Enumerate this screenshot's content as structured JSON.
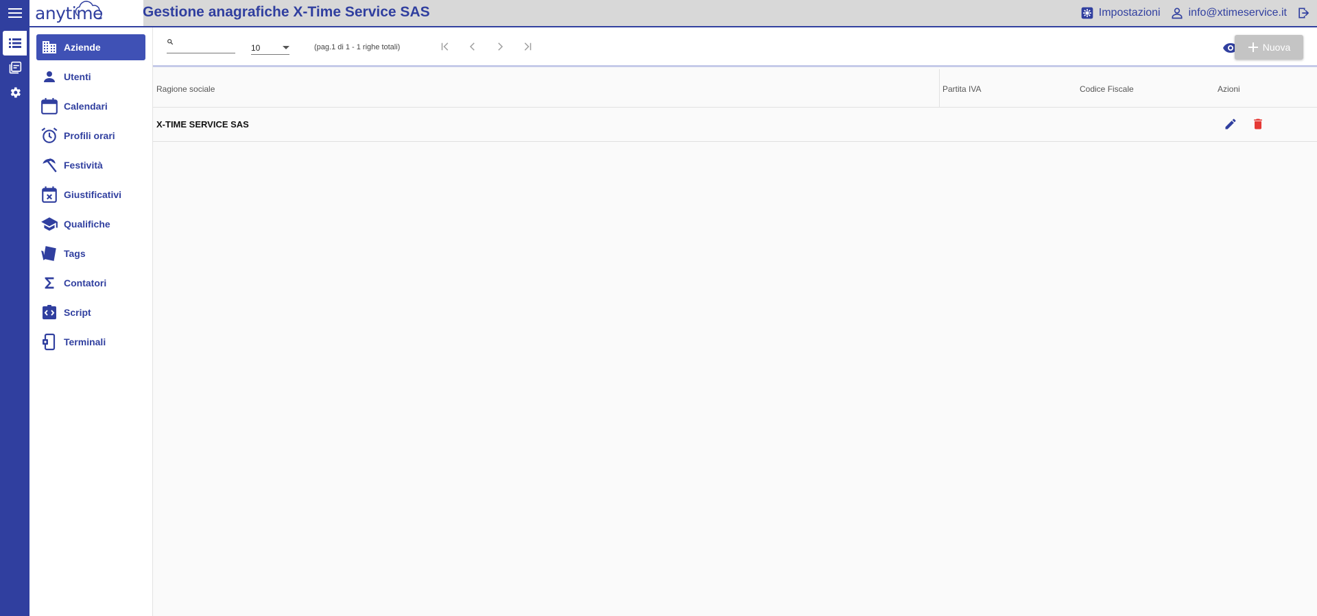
{
  "header": {
    "logo_text": "anytime",
    "title": "Gestione anagrafiche X-Time Service SAS",
    "settings_label": "Impostazioni",
    "user_label": "info@xtimeservice.it"
  },
  "rail": {
    "items": [
      {
        "icon": "list-icon",
        "active": true
      },
      {
        "icon": "library-icon",
        "active": false
      },
      {
        "icon": "gear-icon",
        "active": false
      }
    ]
  },
  "nav": {
    "items": [
      {
        "label": "Aziende",
        "icon": "building-icon",
        "active": true
      },
      {
        "label": "Utenti",
        "icon": "person-icon"
      },
      {
        "label": "Calendari",
        "icon": "calendar-icon"
      },
      {
        "label": "Profili orari",
        "icon": "alarm-icon"
      },
      {
        "label": "Festività",
        "icon": "beach-umbrella-icon"
      },
      {
        "label": "Giustificativi",
        "icon": "event-busy-icon"
      },
      {
        "label": "Qualifiche",
        "icon": "school-icon"
      },
      {
        "label": "Tags",
        "icon": "tag-icon"
      },
      {
        "label": "Contatori",
        "icon": "sigma-icon"
      },
      {
        "label": "Script",
        "icon": "code-icon"
      },
      {
        "label": "Terminali",
        "icon": "device-settings-icon"
      }
    ]
  },
  "toolbar": {
    "search_value": "",
    "page_size": "10",
    "page_info": "(pag.1 di 1 - 1 righe totali)",
    "new_label": "Nuova"
  },
  "table": {
    "columns": [
      "Ragione sociale",
      "Partita IVA",
      "Codice Fiscale",
      "Azioni"
    ],
    "rows": [
      {
        "ragione_sociale": "X-TIME SERVICE SAS",
        "partita_iva": "",
        "codice_fiscale": ""
      }
    ]
  },
  "colors": {
    "primary": "#303f9f",
    "active_nav": "#3f51b5",
    "delete": "#e53935",
    "disabled_button": "#c4c4c4"
  }
}
